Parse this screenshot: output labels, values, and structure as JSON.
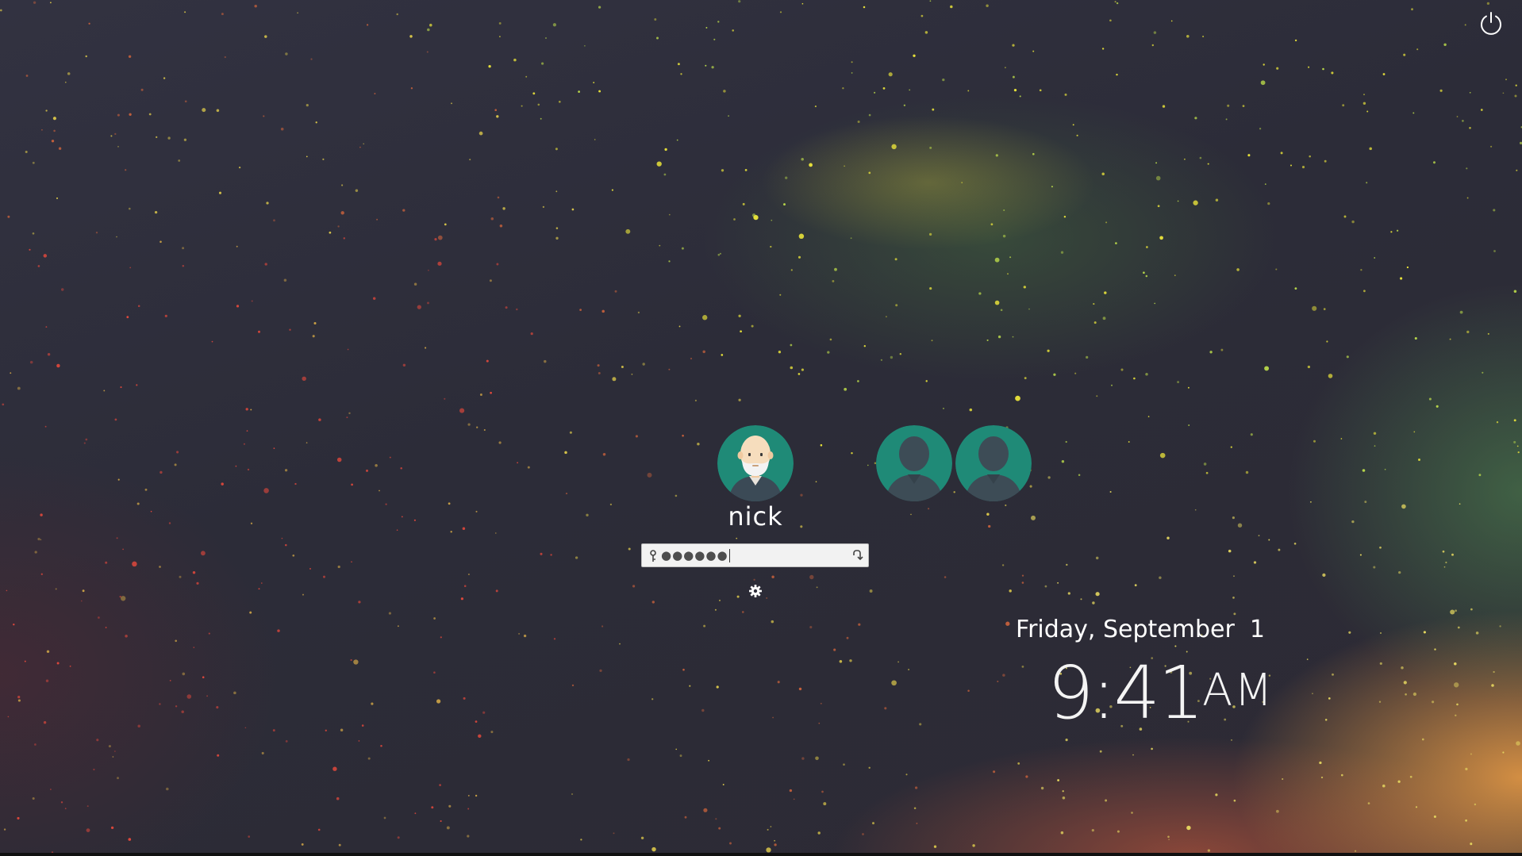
{
  "session": {
    "selected_user": {
      "name": "nick",
      "avatar": "bald-bearded-man-avatar-icon"
    },
    "other_users": [
      {
        "avatar": "default-user-silhouette-icon"
      },
      {
        "avatar": "default-user-silhouette-icon"
      }
    ]
  },
  "password_field": {
    "masked_value": "●●●●●●",
    "key_icon": "key-icon",
    "submit_icon": "enter-arrow-icon"
  },
  "settings_icon": "gear-icon",
  "power_icon": "power-icon",
  "clock": {
    "date": "Friday, September  1",
    "time": "9:41",
    "ampm": "AM"
  },
  "colors": {
    "avatar_bg": "#1f8a77",
    "field_bg": "#f2f2f2",
    "text": "#ffffff"
  }
}
